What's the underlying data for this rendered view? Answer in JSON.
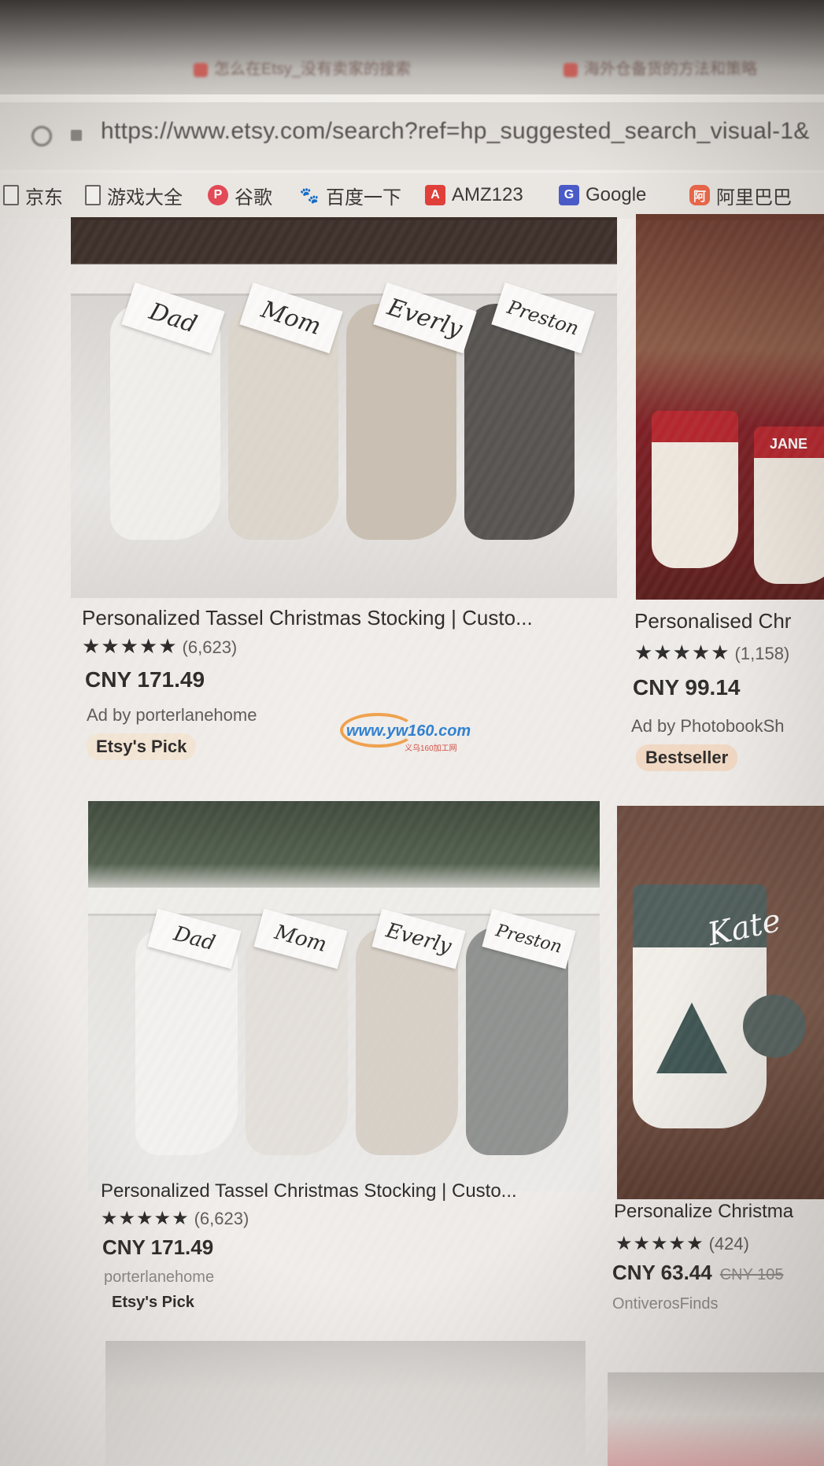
{
  "browser": {
    "tabs": [
      {
        "label": "怎么在Etsy_没有卖家的搜索"
      },
      {
        "label": "海外仓备货的方法和策略"
      }
    ],
    "url": "https://www.etsy.com/search?ref=hp_suggested_search_visual-1&",
    "bookmarks": [
      {
        "label": "京东",
        "icon": "page-icon"
      },
      {
        "label": "游戏大全",
        "icon": "page-icon"
      },
      {
        "label": "谷歌",
        "icon": "p-icon",
        "icon_text": "P",
        "color": "#e24a57"
      },
      {
        "label": "百度一下",
        "icon": "paw-icon",
        "icon_text": "🐾",
        "color": "#2e5fd1"
      },
      {
        "label": "AMZ123",
        "icon": "a-icon",
        "icon_text": "A",
        "color": "#e0403a"
      },
      {
        "label": "Google",
        "icon": "google-icon",
        "icon_text": "G",
        "color": "#4a5bc7"
      },
      {
        "label": "阿里巴巴",
        "icon": "alibaba-icon",
        "icon_text": "阿",
        "color": "#f0694a"
      }
    ]
  },
  "listings": [
    {
      "title": "Personalized Tassel Christmas Stocking | Custo...",
      "stars": "★★★★★",
      "reviews": "(6,623)",
      "price": "CNY 171.49",
      "shop": "Ad by porterlanehome",
      "badge": "Etsy's Pick",
      "names": [
        "Dad",
        "Mom",
        "Everly",
        "Preston"
      ]
    },
    {
      "title": "Personalised Chr",
      "stars": "★★★★★",
      "reviews": "(1,158)",
      "price": "CNY 99.14",
      "shop": "Ad by PhotobookSh",
      "badge": "Bestseller",
      "names": [
        "JANE"
      ]
    },
    {
      "title": "Personalized Tassel Christmas Stocking | Custo...",
      "stars": "★★★★★",
      "reviews": "(6,623)",
      "price": "CNY 171.49",
      "shop": "porterlanehome",
      "badge": "Etsy's Pick",
      "names": [
        "Dad",
        "Mom",
        "Everly",
        "Preston"
      ]
    },
    {
      "title": "Personalize Christma",
      "stars": "★★★★★",
      "reviews": "(424)",
      "price": "CNY 63.44",
      "old_price": "CNY 105",
      "shop": "OntiverosFinds",
      "names": [
        "Kate"
      ]
    }
  ],
  "watermark": {
    "text": "www.yw160.com",
    "subtext": "义乌160加工网"
  }
}
